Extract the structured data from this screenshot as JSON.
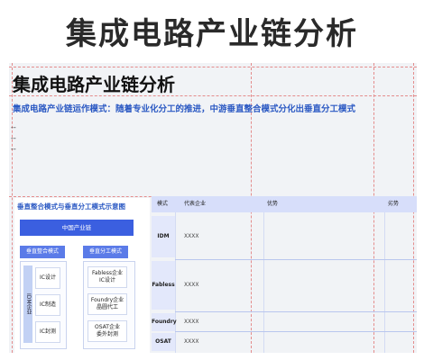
{
  "banner": {
    "title": "集成电路产业链分析"
  },
  "slide": {
    "title": "集成电路产业链分析",
    "subtitle": "集成电路产业链运作模式：随着专业化分工的推进，中游垂直整合模式分化出垂直分工模式",
    "bullets": [
      "--",
      "--",
      "--"
    ]
  },
  "diagram": {
    "title": "垂直整合模式与垂直分工模式示意图",
    "chain_label": "中国产业链",
    "integrated_label": "垂直整合模式",
    "division_label": "垂直分工模式",
    "idm_label": "IDM企业",
    "ic_steps": [
      "IC设计",
      "IC制造",
      "IC封测"
    ],
    "corp_boxes": [
      {
        "line1": "Fabless企业",
        "line2": "IC设计"
      },
      {
        "line1": "Foundry企业",
        "line2": "晶圆代工"
      },
      {
        "line1": "OSAT企业",
        "line2": "委外封测"
      }
    ]
  },
  "table": {
    "headers": [
      "模式",
      "代表企业",
      "优势",
      "劣势"
    ],
    "rows": [
      {
        "mode": "IDM",
        "company": "XXXX"
      },
      {
        "mode": "Fabless",
        "company": "XXXX"
      },
      {
        "mode": "Foundry",
        "company": "XXXX"
      },
      {
        "mode": "OSAT",
        "company": "XXXX"
      }
    ]
  },
  "colors": {
    "accent": "#3b5fe0",
    "subtitle": "#2b59c3",
    "guide": "#e48c8c"
  }
}
